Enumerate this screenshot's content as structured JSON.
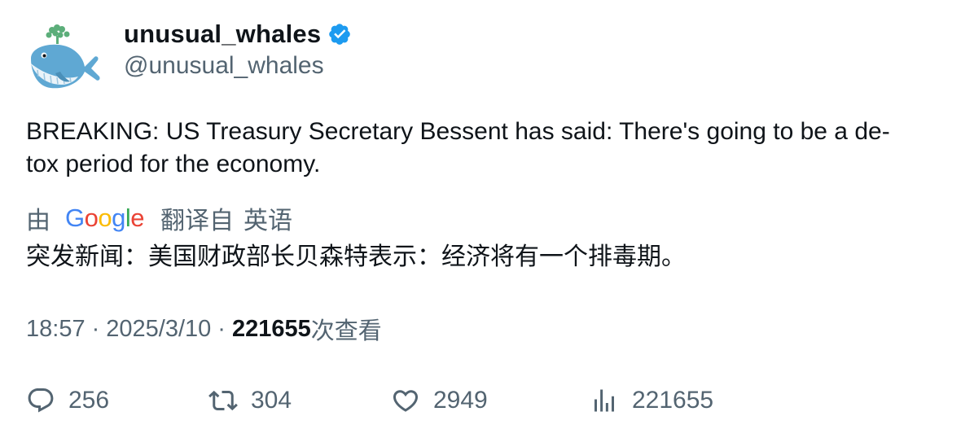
{
  "user": {
    "display_name": "unusual_whales",
    "handle": "@unusual_whales",
    "verified": true,
    "verified_color": "#1d9bf0"
  },
  "tweet": {
    "text": "BREAKING: US Treasury Secretary Bessent has said: There's going to be a de-\ntox period for the economy.",
    "translation": {
      "by_label": "由",
      "provider": "Google",
      "from_label": "翻译自",
      "language": "英语",
      "text": "突发新闻：美国财政部长贝森特表示：经济将有一个排毒期。"
    },
    "time": "18:57",
    "date": "2025/3/10",
    "separator": "·",
    "views_count": "221655",
    "views_label": "次查看"
  },
  "actions": {
    "reply": {
      "icon": "reply-icon",
      "count": "256"
    },
    "retweet": {
      "icon": "retweet-icon",
      "count": "304"
    },
    "like": {
      "icon": "heart-icon",
      "count": "2949"
    },
    "views": {
      "icon": "views-chart-icon",
      "count": "221655"
    }
  },
  "colors": {
    "text_primary": "#0f1419",
    "text_secondary": "#536471",
    "avatar_whale": "#5fa8d3",
    "avatar_spout": "#5cae7a"
  }
}
